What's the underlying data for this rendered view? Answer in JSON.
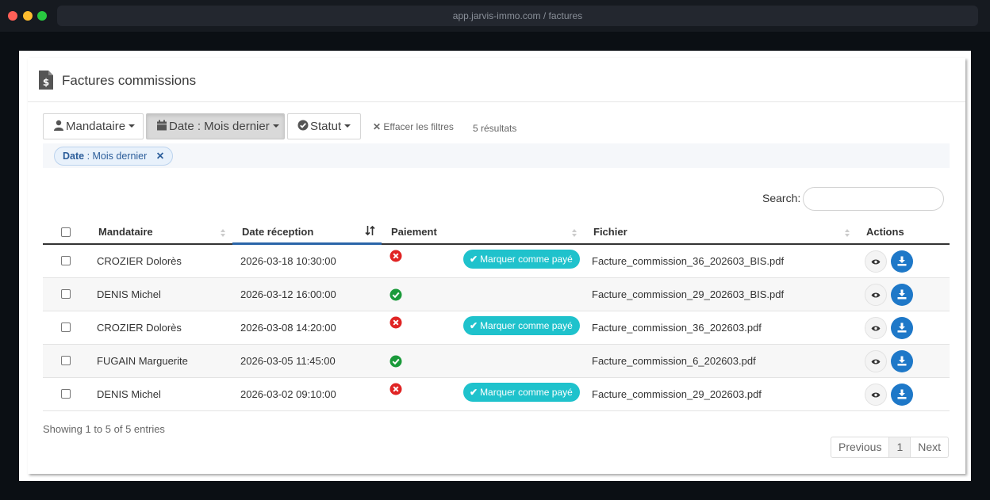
{
  "browser": {
    "url": "app.jarvis-immo.com / factures"
  },
  "header": {
    "title": "Factures commissions",
    "icon": "invoice-dollar-icon"
  },
  "filters": {
    "mandataire_label": "Mandataire",
    "date_label": "Date : Mois dernier",
    "statut_label": "Statut",
    "clear_label": "Effacer les filtres",
    "result_count": "5 résultats",
    "chip_key": "Date",
    "chip_value": ": Mois dernier"
  },
  "search": {
    "label": "Search:",
    "value": "",
    "placeholder": ""
  },
  "table": {
    "columns": [
      "Mandataire",
      "Date réception",
      "Paiement",
      "Fichier",
      "Actions"
    ],
    "pay_button_label": "Marquer comme payé",
    "rows": [
      {
        "mandataire": "CROZIER Dolorès",
        "date": "2026-03-18 10:30:00",
        "paid": false,
        "file": "Facture_commission_36_202603_BIS.pdf"
      },
      {
        "mandataire": "DENIS Michel",
        "date": "2026-03-12 16:00:00",
        "paid": true,
        "file": "Facture_commission_29_202603_BIS.pdf"
      },
      {
        "mandataire": "CROZIER Dolorès",
        "date": "2026-03-08 14:20:00",
        "paid": false,
        "file": "Facture_commission_36_202603.pdf"
      },
      {
        "mandataire": "FUGAIN Marguerite",
        "date": "2026-03-05 11:45:00",
        "paid": true,
        "file": "Facture_commission_6_202603.pdf"
      },
      {
        "mandataire": "DENIS Michel",
        "date": "2026-03-02 09:10:00",
        "paid": false,
        "file": "Facture_commission_29_202603.pdf"
      }
    ]
  },
  "footer": {
    "showing": "Showing 1 to 5 of 5 entries",
    "previous": "Previous",
    "page": "1",
    "next": "Next"
  },
  "colors": {
    "accent_teal": "#1fc2cc",
    "download_blue": "#1e78c8",
    "paid_green": "#1a9a3a",
    "unpaid_red": "#e02424"
  }
}
